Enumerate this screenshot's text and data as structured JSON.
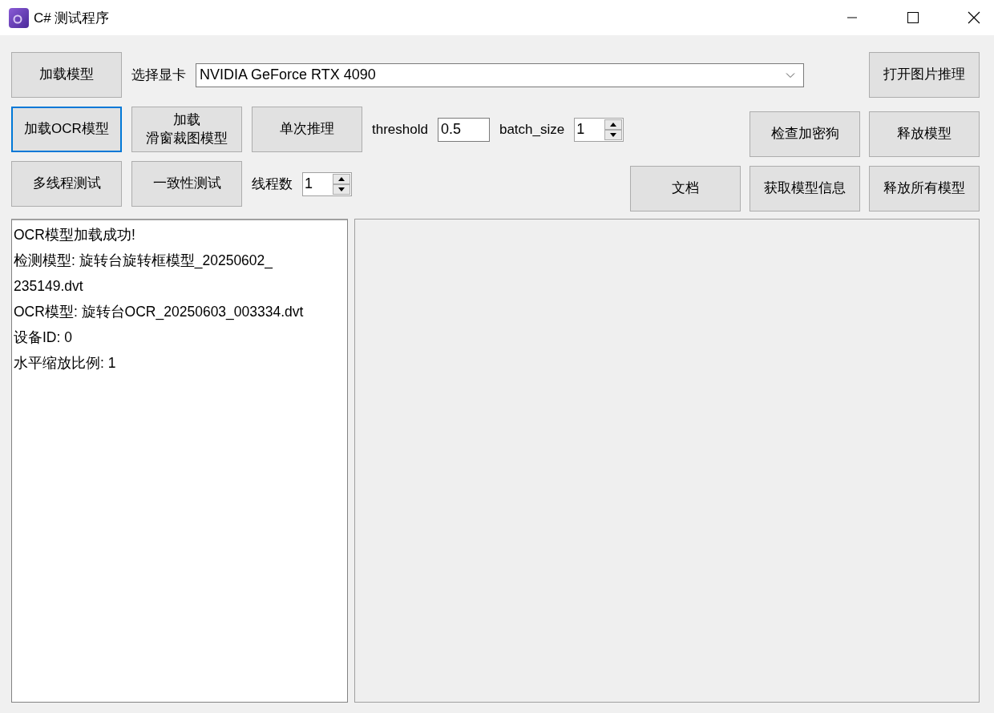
{
  "window": {
    "title": "C# 测试程序"
  },
  "rows": [
    {
      "left": [
        {
          "kind": "button",
          "label": "加载模型",
          "focused": false
        },
        {
          "kind": "label",
          "text": "选择显卡"
        },
        {
          "kind": "combo",
          "value": "NVIDIA GeForce RTX 4090"
        }
      ],
      "right": [
        {
          "kind": "button",
          "label": "打开图片推理",
          "focused": false
        }
      ]
    },
    {
      "left": [
        {
          "kind": "button",
          "label": "加载OCR模型",
          "focused": true
        },
        {
          "kind": "button",
          "label_lines": [
            "加载",
            "滑窗裁图模型"
          ],
          "focused": false
        },
        {
          "kind": "button",
          "label": "单次推理",
          "focused": false
        },
        {
          "kind": "label",
          "text": "threshold"
        },
        {
          "kind": "field",
          "value": "0.5"
        },
        {
          "kind": "label",
          "text": "batch_size"
        },
        {
          "kind": "spin",
          "value": "1"
        }
      ],
      "right": [
        {
          "kind": "button",
          "label": "检查加密狗",
          "focused": false
        },
        {
          "kind": "button",
          "label": "释放模型",
          "focused": false
        }
      ]
    },
    {
      "left": [
        {
          "kind": "button",
          "label": "多线程测试",
          "focused": false
        },
        {
          "kind": "button",
          "label": "一致性测试",
          "focused": false
        },
        {
          "kind": "label",
          "text": "线程数"
        },
        {
          "kind": "spin",
          "value": "1"
        }
      ],
      "right": [
        {
          "kind": "button",
          "label": "文档",
          "focused": false
        },
        {
          "kind": "button",
          "label": "获取模型信息",
          "focused": false
        },
        {
          "kind": "button",
          "label": "释放所有模型",
          "focused": false
        }
      ]
    }
  ],
  "log": {
    "lines": [
      "OCR模型加载成功!",
      "检测模型: 旋转台旋转框模型_20250602_",
      "235149.dvt",
      "OCR模型: 旋转台OCR_20250603_003334.dvt",
      "设备ID: 0",
      "水平缩放比例: 1"
    ]
  }
}
